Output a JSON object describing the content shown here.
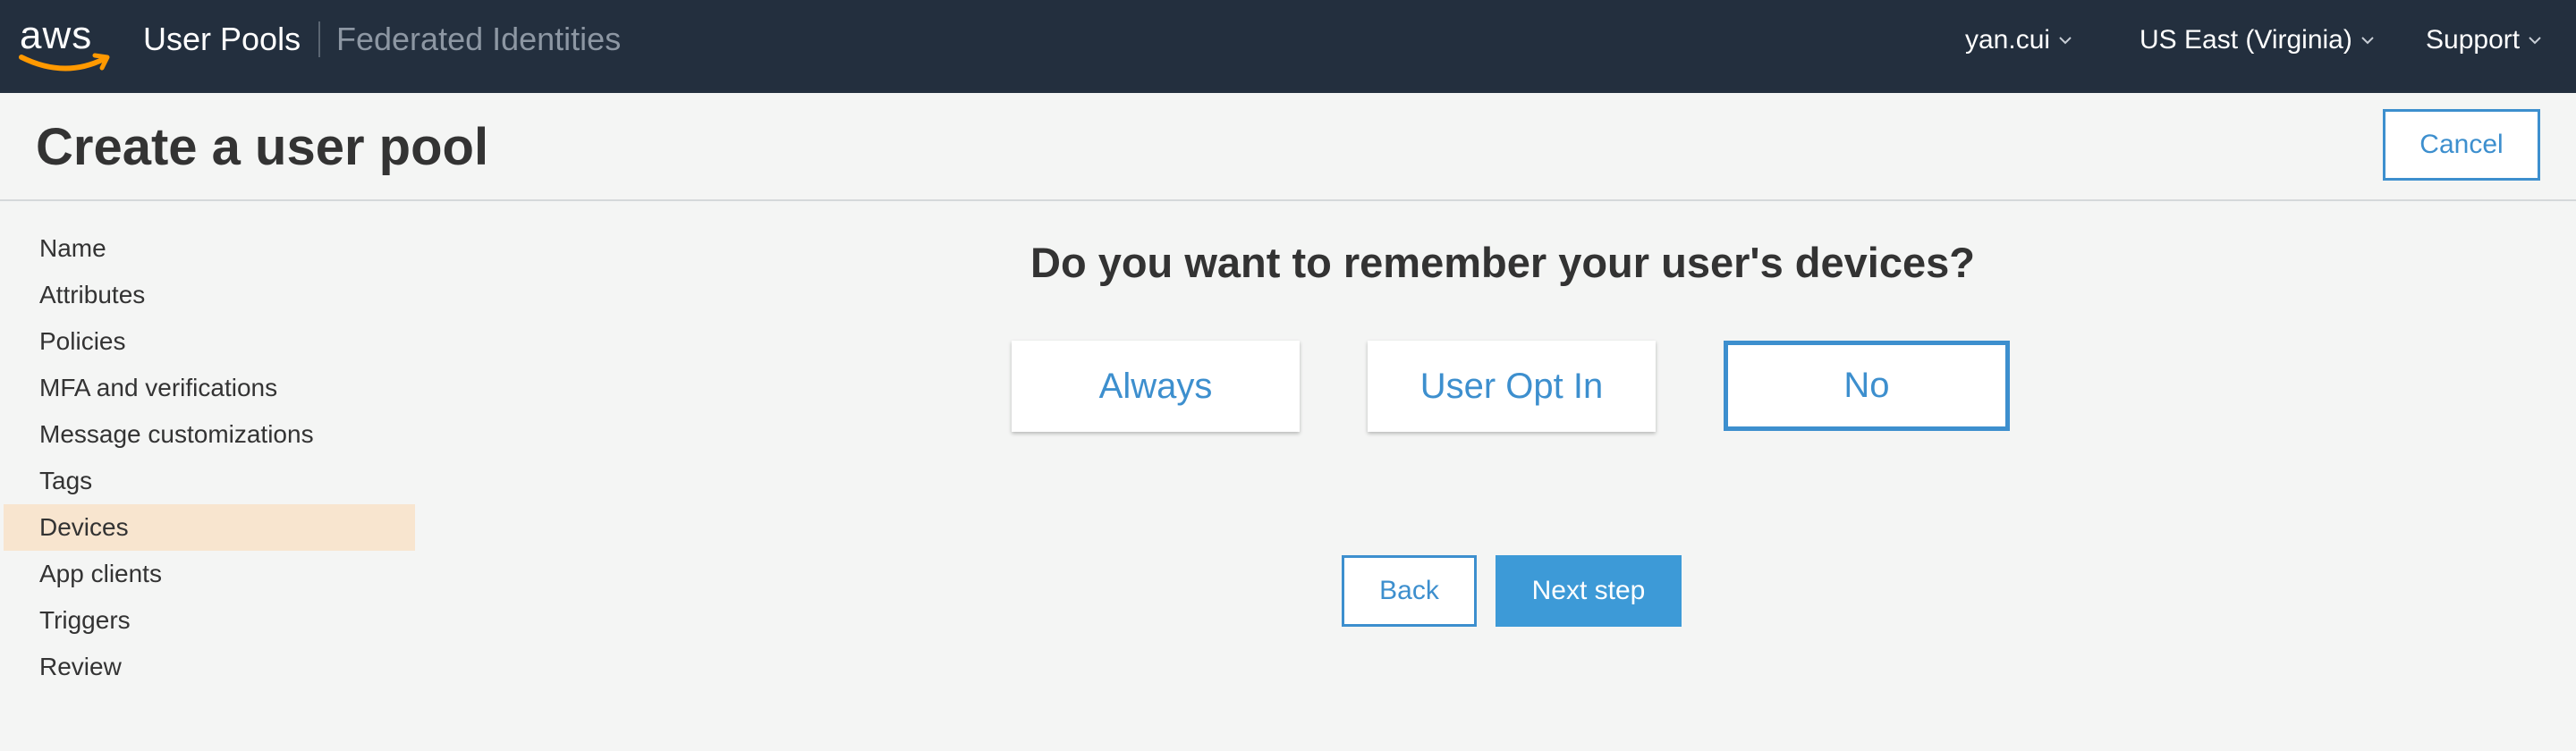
{
  "topbar": {
    "logo_text": "aws",
    "user_pools": "User Pools",
    "federated_identities": "Federated Identities",
    "user_menu": "yan.cui",
    "region_menu": "US East (Virginia)",
    "support_menu": "Support",
    "background_color": "#232f3e"
  },
  "header": {
    "title": "Create a user pool",
    "cancel_label": "Cancel"
  },
  "sidebar": {
    "items": [
      {
        "label": "Name"
      },
      {
        "label": "Attributes"
      },
      {
        "label": "Policies"
      },
      {
        "label": "MFA and verifications"
      },
      {
        "label": "Message customizations"
      },
      {
        "label": "Tags"
      },
      {
        "label": "Devices",
        "active": true
      },
      {
        "label": "App clients"
      },
      {
        "label": "Triggers"
      },
      {
        "label": "Review"
      }
    ]
  },
  "main": {
    "question": "Do you want to remember your user's devices?",
    "options": [
      {
        "label": "Always"
      },
      {
        "label": "User Opt In"
      },
      {
        "label": "No",
        "selected": true
      }
    ],
    "back_label": "Back",
    "next_label": "Next step"
  },
  "colors": {
    "accent": "#3d8fce",
    "primary_button": "#3d9ad7",
    "active_sidebar": "#f8e5cf",
    "page_background": "#f4f5f4"
  },
  "icons": {
    "logo_smile": "amazon-smile-arrow",
    "dropdown": "chevron-down-icon"
  }
}
